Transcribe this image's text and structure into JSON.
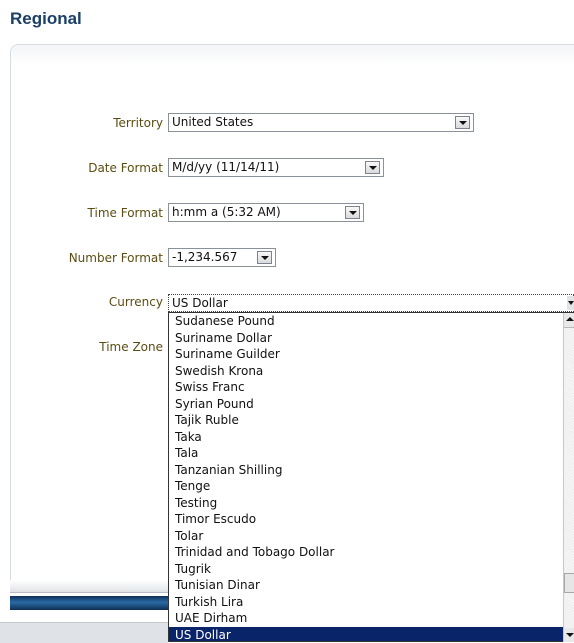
{
  "page": {
    "title": "Regional"
  },
  "form": {
    "territory": {
      "label": "Territory",
      "value": "United States"
    },
    "date_format": {
      "label": "Date Format",
      "value": "M/d/yy (11/14/11)"
    },
    "time_format": {
      "label": "Time Format",
      "value": "h:mm a (5:32 AM)"
    },
    "number_format": {
      "label": "Number Format",
      "value": "-1,234.567"
    },
    "currency": {
      "label": "Currency",
      "value": "US Dollar"
    },
    "time_zone": {
      "label": "Time Zone"
    }
  },
  "currency_dropdown": {
    "options": [
      "Sudanese Pound",
      "Suriname Dollar",
      "Suriname Guilder",
      "Swedish Krona",
      "Swiss Franc",
      "Syrian Pound",
      "Tajik Ruble",
      "Taka",
      "Tala",
      "Tanzanian Shilling",
      "Tenge",
      "Testing",
      "Timor Escudo",
      "Tolar",
      "Trinidad and Tobago Dollar",
      "Tugrik",
      "Tunisian Dinar",
      "Turkish Lira",
      "UAE Dirham",
      "US Dollar"
    ],
    "selected": "US Dollar"
  },
  "colors": {
    "title": "#1c3f66",
    "label": "#5b4d12",
    "selected_option_bg": "#0a246a",
    "bottom_bar": "#1e4f80"
  }
}
